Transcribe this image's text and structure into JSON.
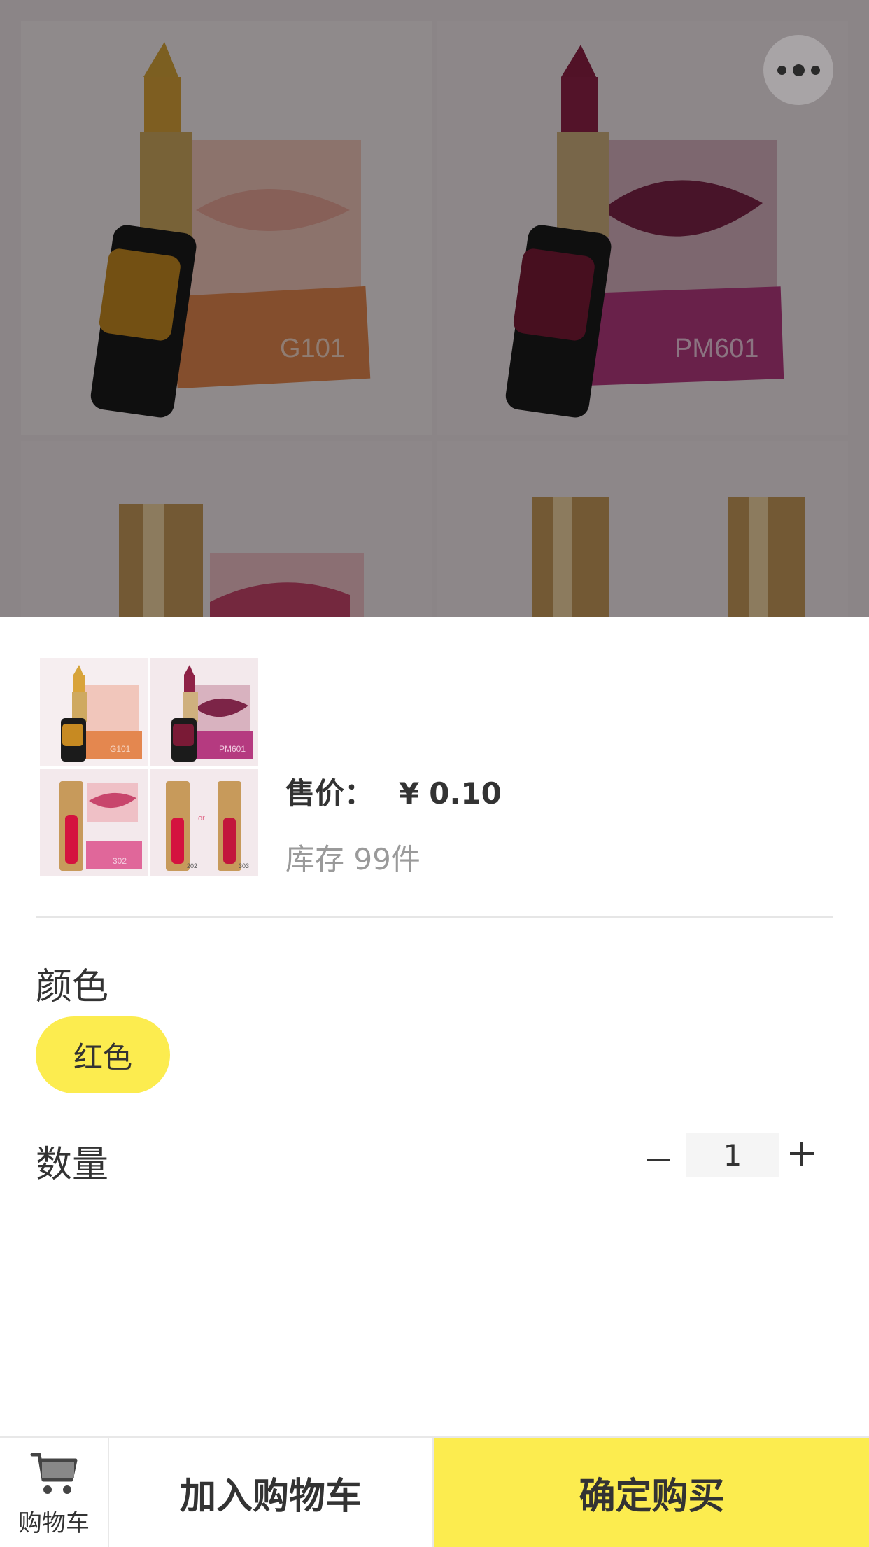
{
  "header": {
    "more_icon": "more-dots-icon"
  },
  "product_image": {
    "swatch_labels": [
      "G101",
      "PM601",
      "302",
      "202",
      "303"
    ],
    "or_label": "or"
  },
  "price": {
    "label": "售价：",
    "currency": "¥",
    "value": "0.10"
  },
  "stock": {
    "text": "库存 99件"
  },
  "spec": {
    "color_title": "颜色",
    "color_options": [
      "红色"
    ],
    "selected_color": "红色"
  },
  "quantity": {
    "title": "数量",
    "value": "1"
  },
  "bottom_bar": {
    "cart_label": "购物车",
    "add_to_cart": "加入购物车",
    "buy_now": "确定购买"
  },
  "colors": {
    "accent": "#fcec4f",
    "text": "#333333",
    "muted": "#9a9a9a"
  }
}
